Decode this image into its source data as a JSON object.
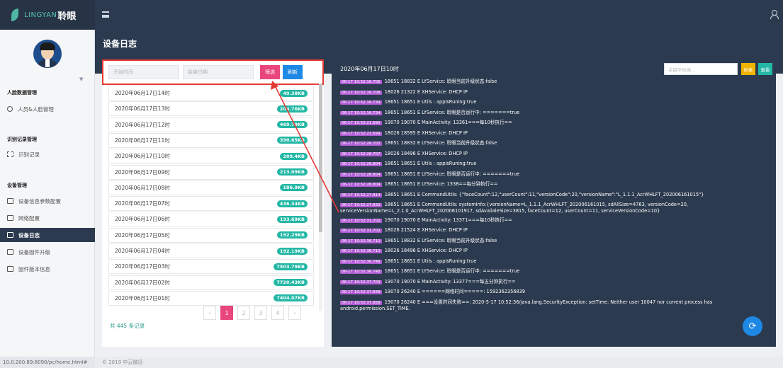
{
  "brand": {
    "name_en": "LINGYAN",
    "name_zh": "聆眼"
  },
  "page_title": "设备日志",
  "sidebar": {
    "sections": [
      {
        "title": "人脸数据管理",
        "items": [
          {
            "label": "人员&人脸管理",
            "icon": "user-icon"
          }
        ]
      },
      {
        "title": "识别记录管理",
        "items": [
          {
            "label": "识别记录",
            "icon": "grid-icon"
          }
        ]
      },
      {
        "title": "设备管理",
        "items": [
          {
            "label": "设备信息参数配置",
            "icon": "square-icon"
          },
          {
            "label": "网络配置",
            "icon": "square-icon"
          },
          {
            "label": "设备日志",
            "icon": "square-icon",
            "active": true
          },
          {
            "label": "设备固件升级",
            "icon": "square-icon"
          },
          {
            "label": "固件版本信息",
            "icon": "square-icon"
          }
        ]
      }
    ]
  },
  "filter": {
    "start_placeholder": "开始时间",
    "end_placeholder": "结束日期",
    "filter_label": "筛选",
    "refresh_label": "刷新"
  },
  "files": [
    {
      "date": "2020年06月17日14时",
      "size": "49.38KB"
    },
    {
      "date": "2020年06月17日13时",
      "size": "204.76KB"
    },
    {
      "date": "2020年06月17日12时",
      "size": "469.79KB"
    },
    {
      "date": "2020年06月17日11时",
      "size": "390.65KB"
    },
    {
      "date": "2020年06月17日10时",
      "size": "209.4KB"
    },
    {
      "date": "2020年06月17日09时",
      "size": "213.09KB"
    },
    {
      "date": "2020年06月17日08时",
      "size": "186.9KB"
    },
    {
      "date": "2020年06月17日07时",
      "size": "436.34KB"
    },
    {
      "date": "2020年06月17日06时",
      "size": "193.69KB"
    },
    {
      "date": "2020年06月17日05时",
      "size": "192.29KB"
    },
    {
      "date": "2020年06月17日04时",
      "size": "192.19KB"
    },
    {
      "date": "2020年06月17日03时",
      "size": "7503.79KB"
    },
    {
      "date": "2020年06月17日02时",
      "size": "7720.43KB"
    },
    {
      "date": "2020年06月17日01时",
      "size": "7404.07KB"
    }
  ],
  "total": "共 445 条记录",
  "pagination": {
    "prev": "‹",
    "pages": [
      "1",
      "2",
      "3",
      "4"
    ],
    "next": "›",
    "current": "1"
  },
  "log": {
    "title": "2020年06月17日10时",
    "search_placeholder": "关键字检索...",
    "search_label": "检索",
    "view_label": "查看",
    "lines": [
      {
        "ts": "06-17 10:52:16.706",
        "text": "18651 18832 E LYService: 聆眼当前升级状态:false"
      },
      {
        "ts": "06-17 10:52:16.708",
        "text": "18026 21322 E XHService: DHCP IP"
      },
      {
        "ts": "06-17 10:52:16.734",
        "text": "18651 18651 E Utils : appIsRuning:true"
      },
      {
        "ts": "06-17 10:52:16.734",
        "text": "18651 18651 E LYService: 聆眼是否运行中: =======true"
      },
      {
        "ts": "06-17 10:52:21.695",
        "text": "19070 19070 E MainActivity: 13361===每10秒执行=="
      },
      {
        "ts": "06-17 10:52:21.699",
        "text": "18026 18595 E XHService: DHCP IP"
      },
      {
        "ts": "06-17 10:52:26.707",
        "text": "18651 18832 E LYService: 聆眼当前升级状态:false"
      },
      {
        "ts": "06-17 10:52:26.707",
        "text": "18026 18496 E XHService: DHCP IP"
      },
      {
        "ts": "06-17 10:52:26.804",
        "text": "18651 18651 E Utils : appIsRuning:true"
      },
      {
        "ts": "06-17 10:52:26.804",
        "text": "18651 18651 E LYService: 聆眼是否运行中: =======true"
      },
      {
        "ts": "06-17 10:52:26.804",
        "text": "18651 18651 E LYService: 1338==每分钟执行=="
      },
      {
        "ts": "06-17 10:52:27.814",
        "text": "18651 18651 E CommandUtils: {\"faceCount\":12,\"userCount\":11,\"versionCode\":20,\"versionName\":\"L_1.1.1_AcrWHLFT_202006161015\"}"
      },
      {
        "ts": "06-17 10:52:27.830",
        "text": "18651 18651 E CommandUtils: systemInfo:{versionName=L_1.1.1_AcrWHLFT_202006161015, sdAllSize=4763, versionCode=20, serviceVersionName=L_2.1.0_AcrWHLFT_202006101917, sdAvailaleSize=3815, faceCount=12, userCount=11, serviceVersionCode=10}"
      },
      {
        "ts": "06-17 10:52:31.702",
        "text": "19070 19070 E MainActivity: 13371===每10秒执行=="
      },
      {
        "ts": "06-17 10:52:31.702",
        "text": "18026 21524 E XHService: DHCP IP"
      },
      {
        "ts": "06-17 10:52:36.710",
        "text": "18651 18832 E LYService: 聆眼当前升级状态:false"
      },
      {
        "ts": "06-17 10:52:36.710",
        "text": "18026 18496 E XHService: DHCP IP"
      },
      {
        "ts": "06-17 10:52:36.748",
        "text": "18651 18651 E Utils : appIsRuning:true"
      },
      {
        "ts": "06-17 10:52:36.748",
        "text": "18651 18651 E LYService: 聆眼是否运行中: =======true"
      },
      {
        "ts": "06-17 10:52:37.703",
        "text": "19070 19070 E MainActivity: 13377===每五分钟执行=="
      },
      {
        "ts": "06-17 10:52:37.848",
        "text": "19070 26240 E ======网络时间=====: 1592362356839"
      },
      {
        "ts": "06-17 10:52:37.858",
        "text": "19070 26240 E ===设置时间失败==: 2020-5-17 10:52:36/java.lang.SecurityException: setTime: Neither user 10047 nor current process has android.permission.SET_TIME."
      }
    ]
  },
  "status_url": "10.0.200.89:8090/pc/home.html#",
  "copyright": "© 2019 中云微迅",
  "colors": {
    "header": "#2b3a4e",
    "accent": "#23b7a5",
    "pink": "#e8467c",
    "blue": "#1e88e5",
    "highlight": "#e53935",
    "timestamp": "#b05bd4"
  }
}
